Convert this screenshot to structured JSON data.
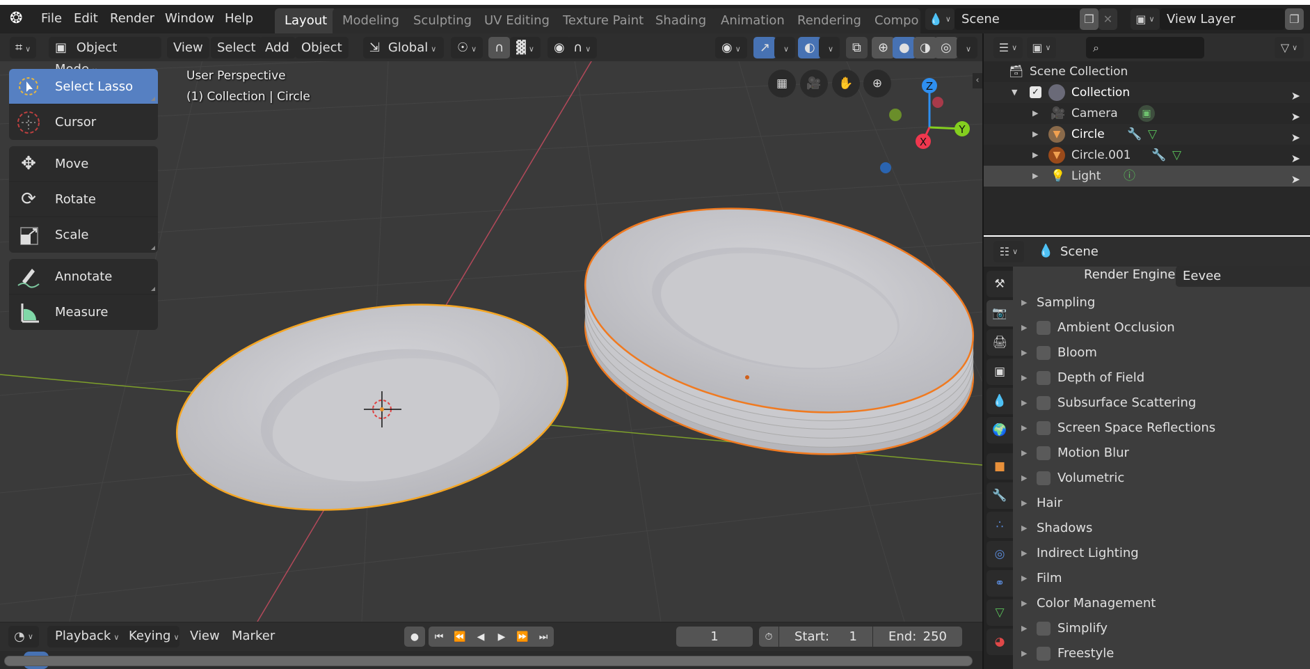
{
  "topbar": {
    "menus": [
      "File",
      "Edit",
      "Render",
      "Window",
      "Help"
    ],
    "workspaces": [
      {
        "label": "Layout",
        "active": true
      },
      {
        "label": "Modeling",
        "active": false
      },
      {
        "label": "Sculpting",
        "active": false
      },
      {
        "label": "UV Editing",
        "active": false
      },
      {
        "label": "Texture Paint",
        "active": false
      },
      {
        "label": "Shading",
        "active": false
      },
      {
        "label": "Animation",
        "active": false
      },
      {
        "label": "Rendering",
        "active": false
      },
      {
        "label": "Compo",
        "active": false
      }
    ],
    "scene_field": "Scene",
    "view_layer_field": "View Layer"
  },
  "viewport": {
    "header": {
      "mode": "Object Mode",
      "menus": [
        "View",
        "Select",
        "Add",
        "Object"
      ],
      "transform_orientation": "Global"
    },
    "overlay_text": {
      "perspective": "User Perspective",
      "collection_info": "(1) Collection | Circle"
    },
    "tools": [
      {
        "label": "Select Lasso",
        "icon": "select-lasso-icon",
        "active": true
      },
      {
        "label": "Cursor",
        "icon": "cursor-icon",
        "active": false
      },
      {
        "label": "Move",
        "icon": "move-icon",
        "active": false
      },
      {
        "label": "Rotate",
        "icon": "rotate-icon",
        "active": false
      },
      {
        "label": "Scale",
        "icon": "scale-icon",
        "active": false
      },
      {
        "label": "Annotate",
        "icon": "annotate-icon",
        "active": false
      },
      {
        "label": "Measure",
        "icon": "measure-icon",
        "active": false
      }
    ],
    "gizmo": {
      "x": "X",
      "y": "Y",
      "z": "Z"
    },
    "colors": {
      "x_axis": "#f0374e",
      "y_axis": "#84cf1f",
      "z_axis": "#2e8ff0",
      "selection": "#f5a623",
      "active_tool": "#5680c2"
    }
  },
  "outliner": {
    "root": "Scene Collection",
    "items": [
      {
        "label": "Collection",
        "type": "collection"
      },
      {
        "label": "Camera",
        "type": "camera"
      },
      {
        "label": "Circle",
        "type": "mesh"
      },
      {
        "label": "Circle.001",
        "type": "mesh"
      },
      {
        "label": "Light",
        "type": "light"
      }
    ]
  },
  "properties": {
    "context": "Scene",
    "render_engine_label": "Render Engine",
    "render_engine_value": "Eevee",
    "panels": [
      {
        "label": "Sampling",
        "checkbox": false
      },
      {
        "label": "Ambient Occlusion",
        "checkbox": true,
        "checked": false
      },
      {
        "label": "Bloom",
        "checkbox": true,
        "checked": false
      },
      {
        "label": "Depth of Field",
        "checkbox": true,
        "checked": false
      },
      {
        "label": "Subsurface Scattering",
        "checkbox": true,
        "checked": false
      },
      {
        "label": "Screen Space Reflections",
        "checkbox": true,
        "checked": false
      },
      {
        "label": "Motion Blur",
        "checkbox": true,
        "checked": false
      },
      {
        "label": "Volumetric",
        "checkbox": true,
        "checked": false
      },
      {
        "label": "Hair",
        "checkbox": false
      },
      {
        "label": "Shadows",
        "checkbox": false
      },
      {
        "label": "Indirect Lighting",
        "checkbox": false
      },
      {
        "label": "Film",
        "checkbox": false
      },
      {
        "label": "Color Management",
        "checkbox": false
      },
      {
        "label": "Simplify",
        "checkbox": true,
        "checked": false
      },
      {
        "label": "Freestyle",
        "checkbox": true,
        "checked": false
      }
    ]
  },
  "timeline": {
    "menus": [
      "Playback",
      "Keying",
      "View",
      "Marker"
    ],
    "current_frame": "1",
    "start_label": "Start:",
    "start_value": "1",
    "end_label": "End:",
    "end_value": "250"
  }
}
